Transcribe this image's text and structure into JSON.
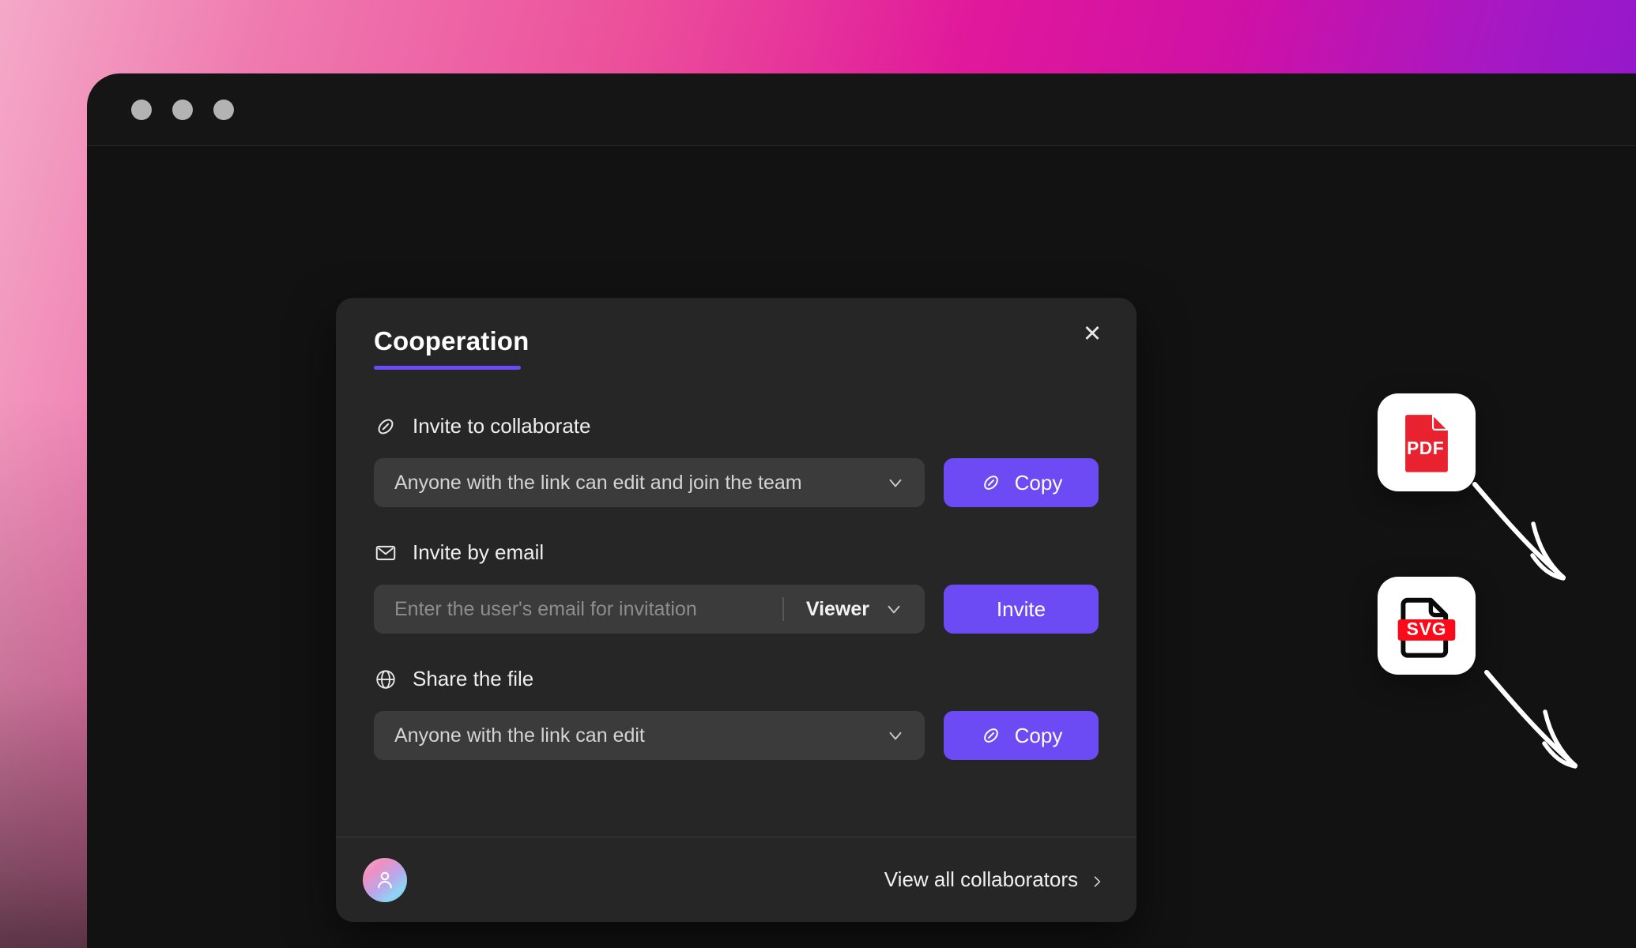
{
  "window": {
    "traffic_lights": [
      "close-dot",
      "minimize-dot",
      "maximize-dot"
    ]
  },
  "dialog": {
    "title": "Cooperation",
    "close_label": "✕",
    "sections": [
      {
        "id": "invite-to-collaborate",
        "icon": "link-icon",
        "label": "Invite to collaborate",
        "select_value": "Anyone with the link can edit and join the team",
        "button_label": "Copy",
        "button_icon": "link-icon"
      },
      {
        "id": "invite-by-email",
        "icon": "mail-icon",
        "label": "Invite by email",
        "input_placeholder": "Enter the user's email for invitation",
        "input_value": "",
        "role_value": "Viewer",
        "button_label": "Invite"
      },
      {
        "id": "share-the-file",
        "icon": "globe-icon",
        "label": "Share the file",
        "select_value": "Anyone with the link can edit",
        "button_label": "Copy",
        "button_icon": "link-icon"
      }
    ],
    "footer": {
      "avatar_icon": "user-avatar",
      "view_all_label": "View all collaborators",
      "chevron": "chevron-right-icon"
    }
  },
  "file_badges": [
    {
      "id": "pdf-badge",
      "label": "PDF",
      "color": "#e8222e"
    },
    {
      "id": "svg-badge",
      "label": "SVG",
      "color": "#fb0b19"
    }
  ],
  "colors": {
    "accent": "#6c4bf4",
    "dialog_bg": "#262626",
    "field_bg": "#3b3b3b",
    "app_bg": "#121212",
    "window_bg": "#151515"
  }
}
